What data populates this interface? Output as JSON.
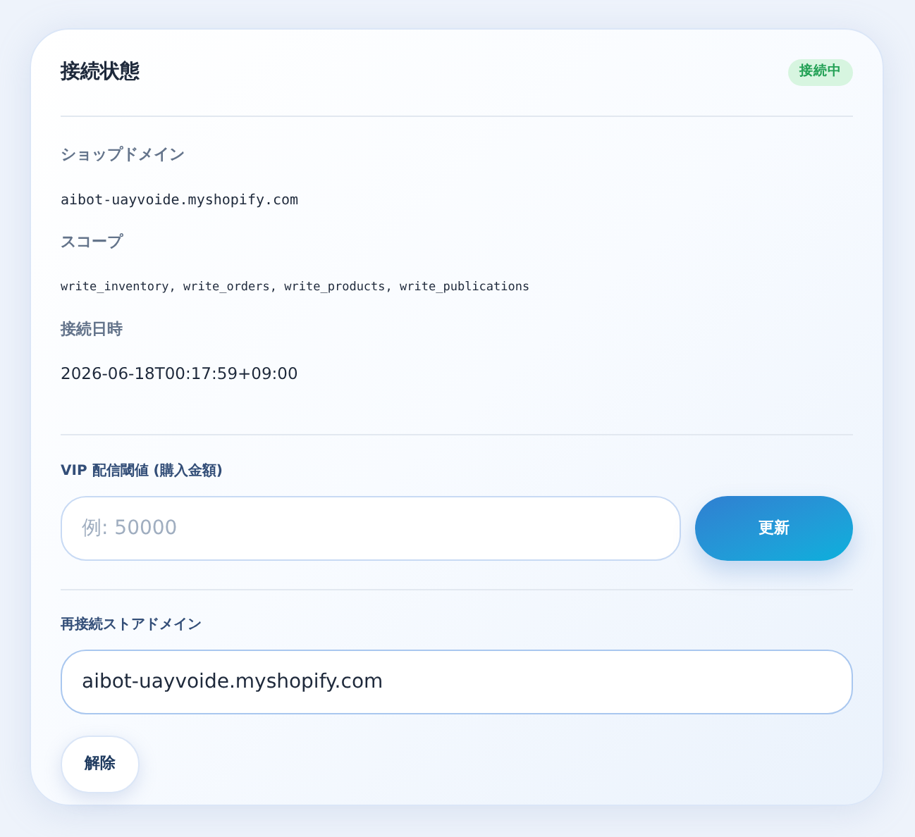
{
  "card": {
    "title": "接続状態",
    "status_badge": "接続中",
    "fields": [
      {
        "label": "ショップドメイン",
        "value": "aibot-uayvoide.myshopify.com",
        "kind": "mono"
      },
      {
        "label": "スコープ",
        "value": "write_inventory, write_orders, write_products, write_publications",
        "kind": "mono-small"
      },
      {
        "label": "接続日時",
        "value": "2026-06-18T00:17:59+09:00",
        "kind": "text"
      }
    ],
    "vip": {
      "label": "VIP 配信閾値 (購入金額)",
      "placeholder": "例: 50000",
      "button": "更新"
    },
    "reconnect": {
      "label": "再接続ストアドメイン",
      "value": "aibot-uayvoide.myshopify.com",
      "button": "解除"
    }
  }
}
